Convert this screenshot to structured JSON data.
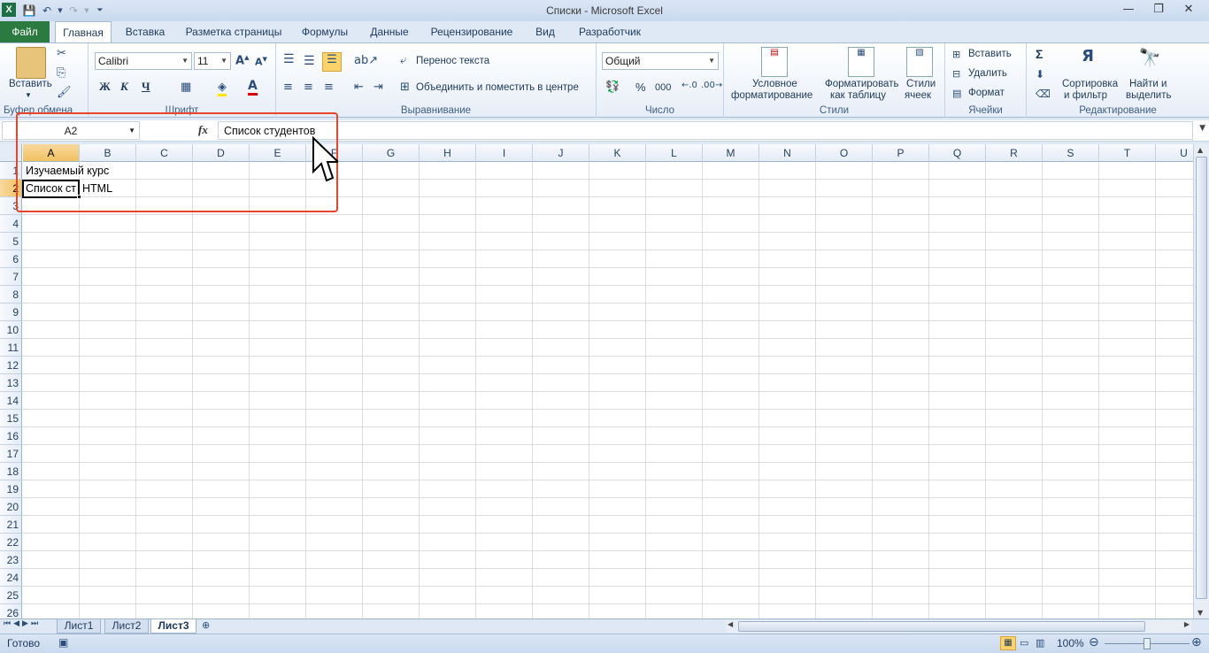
{
  "window": {
    "title": "Списки  -  Microsoft Excel",
    "app_icon": "X"
  },
  "ribbon_tabs": [
    "Файл",
    "Главная",
    "Вставка",
    "Разметка страницы",
    "Формулы",
    "Данные",
    "Рецензирование",
    "Вид",
    "Разработчик"
  ],
  "ribbon": {
    "clipboard": {
      "paste_label": "Вставить",
      "group_label": "Буфер обмена"
    },
    "font": {
      "family": "Calibri",
      "size": "11",
      "bold": "Ж",
      "italic": "К",
      "underline": "Ч",
      "group_label": "Шрифт"
    },
    "alignment": {
      "wrap_label": "Перенос текста",
      "merge_label": "Объединить и поместить в центре",
      "group_label": "Выравнивание"
    },
    "number": {
      "format": "Общий",
      "percent": "%",
      "thousands": "000",
      "group_label": "Число"
    },
    "styles": {
      "conditional_1": "Условное",
      "conditional_2": "форматирование",
      "astable_1": "Форматировать",
      "astable_2": "как таблицу",
      "cellstyles_1": "Стили",
      "cellstyles_2": "ячеек",
      "group_label": "Стили"
    },
    "cells": {
      "insert_label": "Вставить",
      "delete_label": "Удалить",
      "format_label": "Формат",
      "group_label": "Ячейки"
    },
    "editing": {
      "sigma": "Σ",
      "sort_1": "Сортировка",
      "sort_2": "и фильтр",
      "find_1": "Найти и",
      "find_2": "выделить",
      "group_label": "Редактирование"
    }
  },
  "formula_bar": {
    "name_box": "A2",
    "fx_label": "fx",
    "content": "Список студентов"
  },
  "columns": [
    "A",
    "B",
    "C",
    "D",
    "E",
    "F",
    "G",
    "H",
    "I",
    "J",
    "K",
    "L",
    "M",
    "N",
    "O",
    "P",
    "Q",
    "R",
    "S",
    "T",
    "U"
  ],
  "rows": [
    "1",
    "2",
    "3",
    "4",
    "5",
    "6",
    "7",
    "8",
    "9",
    "10",
    "11",
    "12",
    "13",
    "14",
    "15",
    "16",
    "17",
    "18",
    "19",
    "20",
    "21",
    "22",
    "23",
    "24",
    "25",
    "26"
  ],
  "cells": {
    "A1": "Изучаемый курс",
    "A2": "Список ст",
    "B2": "HTML"
  },
  "sheets": [
    "Лист1",
    "Лист2",
    "Лист3"
  ],
  "active_sheet": "Лист3",
  "status": {
    "ready": "Готово",
    "zoom": "100%"
  }
}
